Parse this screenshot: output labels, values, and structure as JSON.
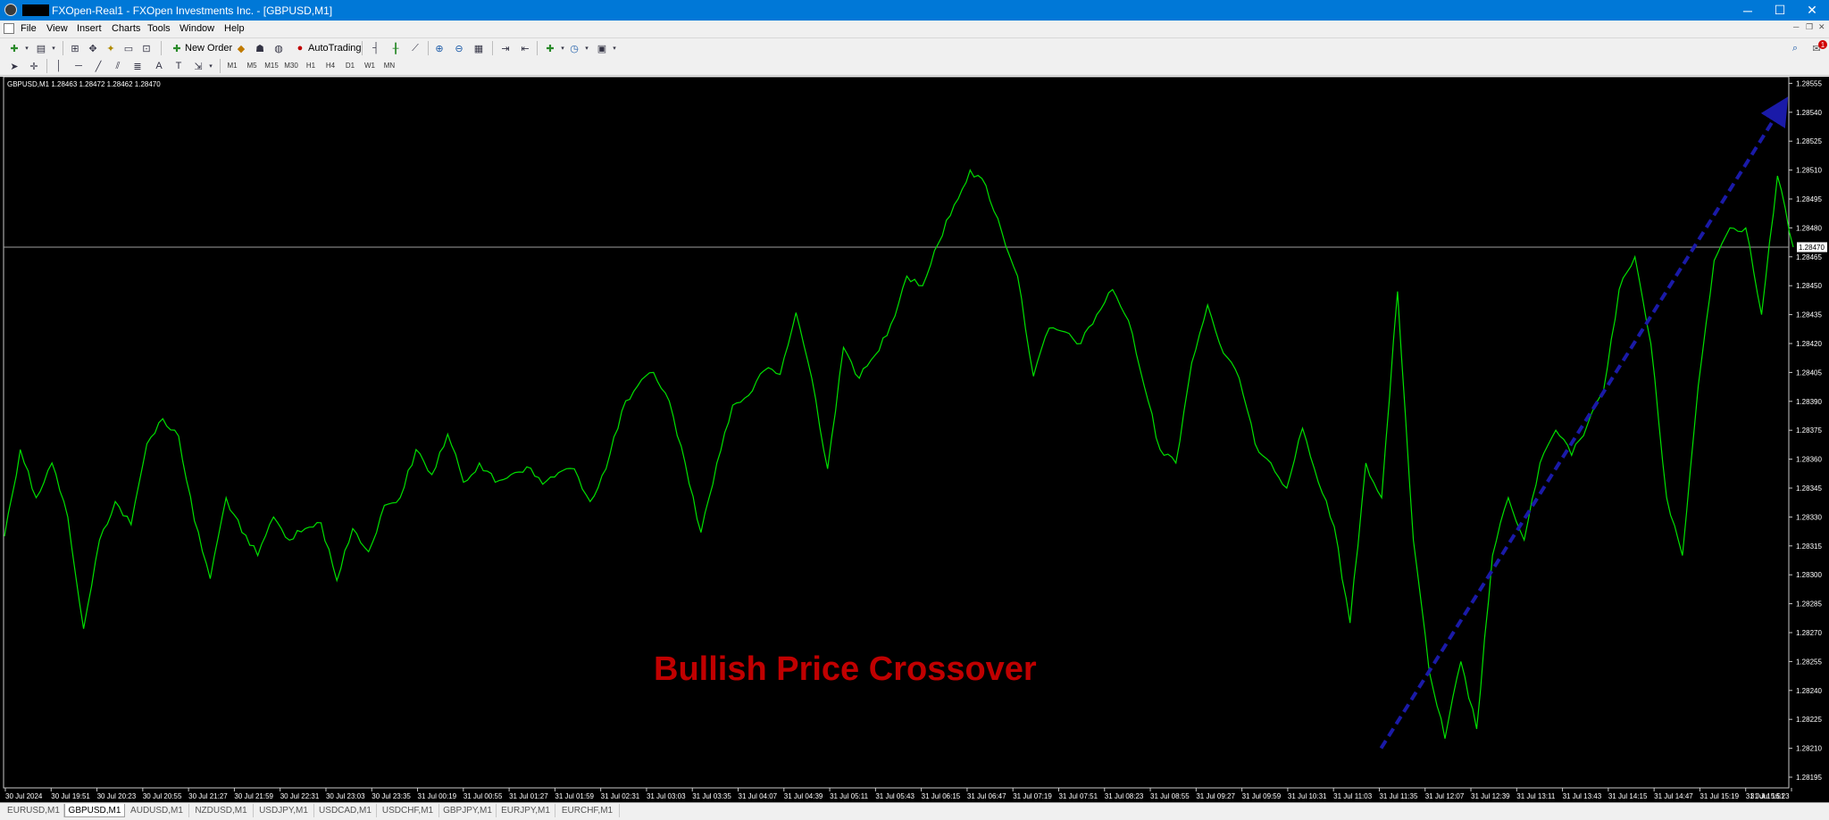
{
  "window": {
    "title": "FXOpen-Real1 - FXOpen Investments Inc. - [GBPUSD,M1]",
    "controls": [
      "─",
      "☐",
      "✕"
    ]
  },
  "menu": {
    "items": [
      "File",
      "View",
      "Insert",
      "Charts",
      "Tools",
      "Window",
      "Help"
    ],
    "mdi_controls": [
      "─",
      "❐",
      "✕"
    ]
  },
  "toolbar": {
    "new_order": "New Order",
    "autotrading": "AutoTrading",
    "notification_count": "1",
    "timeframes": [
      "M1",
      "M5",
      "M15",
      "M30",
      "H1",
      "H4",
      "D1",
      "W1",
      "MN"
    ]
  },
  "chart": {
    "info": "GBPUSD,M1  1.28463 1.28472 1.28462 1.28470",
    "current_price": "1.28470",
    "annotation": "Bullish Price Crossover",
    "colors": {
      "background": "#000000",
      "line": "#00e000",
      "annotation": "#c00000",
      "trend_arrow": "#1a1aa8",
      "price_line": "#a0a0a0"
    },
    "price_labels": [
      "1.28555",
      "1.28540",
      "1.28525",
      "1.28510",
      "1.28495",
      "1.28480",
      "1.28465",
      "1.28450",
      "1.28435",
      "1.28420",
      "1.28405",
      "1.28390",
      "1.28375",
      "1.28360",
      "1.28345",
      "1.28330",
      "1.28315",
      "1.28300",
      "1.28285",
      "1.28270",
      "1.28255",
      "1.28240",
      "1.28225",
      "1.28210",
      "1.28195"
    ],
    "time_labels": [
      "30 Jul 2024",
      "30 Jul 19:51",
      "30 Jul 20:23",
      "30 Jul 20:55",
      "30 Jul 21:27",
      "30 Jul 21:59",
      "30 Jul 22:31",
      "30 Jul 23:03",
      "30 Jul 23:35",
      "31 Jul 00:19",
      "31 Jul 00:55",
      "31 Jul 01:27",
      "31 Jul 01:59",
      "31 Jul 02:31",
      "31 Jul 03:03",
      "31 Jul 03:35",
      "31 Jul 04:07",
      "31 Jul 04:39",
      "31 Jul 05:11",
      "31 Jul 05:43",
      "31 Jul 06:15",
      "31 Jul 06:47",
      "31 Jul 07:19",
      "31 Jul 07:51",
      "31 Jul 08:23",
      "31 Jul 08:55",
      "31 Jul 09:27",
      "31 Jul 09:59",
      "31 Jul 10:31",
      "31 Jul 11:03",
      "31 Jul 11:35",
      "31 Jul 12:07",
      "31 Jul 12:39",
      "31 Jul 13:11",
      "31 Jul 13:43",
      "31 Jul 14:15",
      "31 Jul 14:47",
      "31 Jul 15:19",
      "31 Jul 15:51",
      "31 Jul 16:23"
    ]
  },
  "chart_data": {
    "type": "line",
    "symbol": "GBPUSD",
    "timeframe": "M1",
    "ylim": [
      1.28195,
      1.2856
    ],
    "x_start": "30 Jul 2024",
    "x_end": "31 Jul 16:23",
    "values": [
      1.2832,
      1.28365,
      1.2834,
      1.28358,
      1.2833,
      1.28272,
      1.28318,
      1.28338,
      1.28326,
      1.28368,
      1.28381,
      1.28372,
      1.28328,
      1.28298,
      1.2834,
      1.28322,
      1.2831,
      1.2833,
      1.28318,
      1.28324,
      1.28327,
      1.28297,
      1.28324,
      1.28312,
      1.28336,
      1.2834,
      1.28365,
      1.28352,
      1.28373,
      1.28348,
      1.28358,
      1.28348,
      1.28352,
      1.28356,
      1.28347,
      1.28353,
      1.28355,
      1.28338,
      1.28355,
      1.28385,
      1.28398,
      1.28405,
      1.2839,
      1.28358,
      1.28322,
      1.28358,
      1.28388,
      1.28393,
      1.28406,
      1.28404,
      1.28436,
      1.28402,
      1.28355,
      1.28418,
      1.28402,
      1.28414,
      1.2843,
      1.28455,
      1.2845,
      1.28472,
      1.28492,
      1.2851,
      1.28502,
      1.28478,
      1.28455,
      1.28403,
      1.28428,
      1.28426,
      1.2842,
      1.28435,
      1.28448,
      1.28432,
      1.28398,
      1.28365,
      1.28358,
      1.2841,
      1.2844,
      1.28415,
      1.28402,
      1.28368,
      1.28358,
      1.28345,
      1.28376,
      1.28348,
      1.28325,
      1.28275,
      1.28358,
      1.2834,
      1.28447,
      1.28318,
      1.2825,
      1.28215,
      1.28255,
      1.2822,
      1.2831,
      1.2834,
      1.28318,
      1.28358,
      1.28375,
      1.28362,
      1.28378,
      1.28395,
      1.28448,
      1.28465,
      1.2842,
      1.2834,
      1.2831,
      1.28398,
      1.28463,
      1.2848,
      1.2848,
      1.28435,
      1.28507,
      1.2847
    ],
    "trend_arrow": {
      "from": [
        "31 Jul 11:35",
        1.2821
      ],
      "to": [
        "31 Jul 16:23",
        1.28545
      ]
    }
  }
}
